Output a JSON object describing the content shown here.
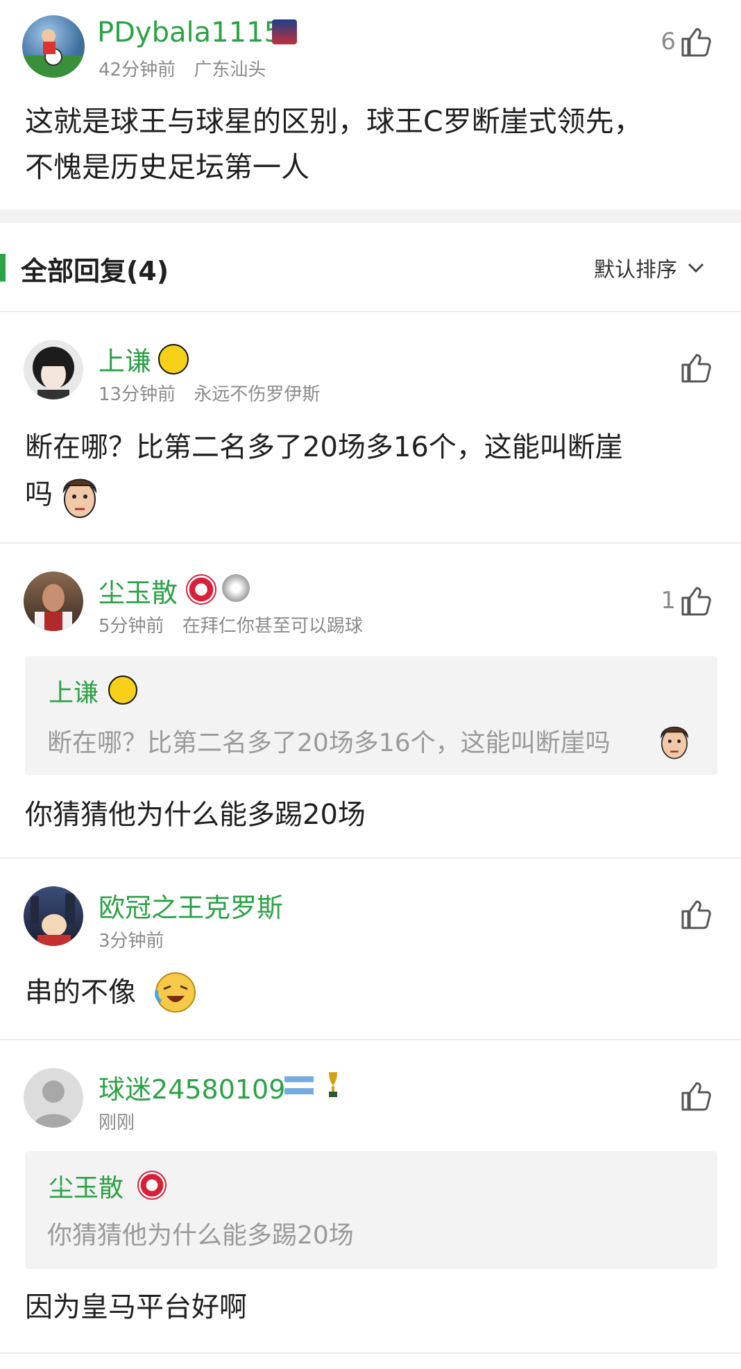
{
  "main_post": {
    "username": "PDybala1115",
    "time": "42分钟前",
    "location": "广东汕头",
    "like_count": "6",
    "text_line1": "这就是球王与球星的区别，球王C罗断崖式领先，",
    "text_line2": "不愧是历史足坛第一人"
  },
  "replies_header": {
    "title": "全部回复(4)",
    "sort_label": "默认排序"
  },
  "replies": [
    {
      "username": "上谦",
      "time": "13分钟前",
      "tag": "永远不伤罗伊斯",
      "like_count": "",
      "text_line1": "断在哪？比第二名多了20场多16个，这能叫断崖",
      "text_line2": "吗"
    },
    {
      "username": "尘玉散",
      "time": "5分钟前",
      "tag": "在拜仁你甚至可以踢球",
      "like_count": "1",
      "quote_name": "上谦",
      "quote_text": "断在哪？比第二名多了20场多16个，这能叫断崖吗",
      "text_line1": "你猜猜他为什么能多踢20场"
    },
    {
      "username": "欧冠之王克罗斯",
      "time": "3分钟前",
      "like_count": "",
      "text_line1": "串的不像"
    },
    {
      "username": "球迷24580109",
      "time": "刚刚",
      "like_count": "",
      "quote_name": "尘玉散",
      "quote_text": "你猜猜他为什么能多踢20场",
      "text_line1": "因为皇马平台好啊"
    }
  ],
  "icons": {
    "like": "thumbs-up-icon",
    "sort": "chevron-down-icon",
    "emoji": "face-emoji-icon"
  },
  "colors": {
    "username": "#2ba245",
    "accent_bar": "#2ba245",
    "meta": "#8a8a8a",
    "quote_bg": "#f3f3f3"
  }
}
